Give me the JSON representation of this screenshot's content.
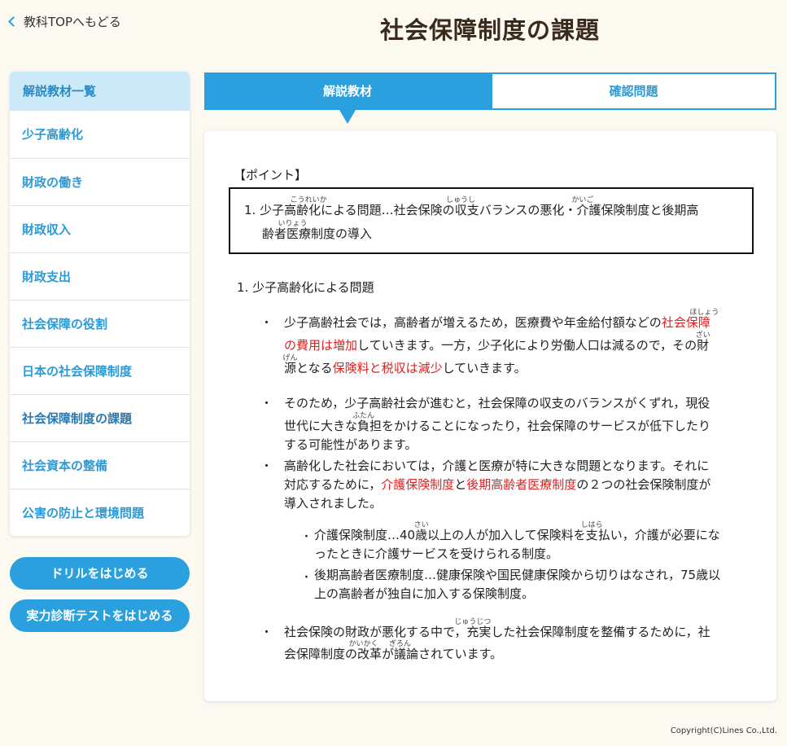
{
  "back_link": "教科TOPへもどる",
  "title": "社会保障制度の課題",
  "sidebar": {
    "header": "解説教材一覧",
    "items": [
      "少子高齢化",
      "財政の働き",
      "財政収入",
      "財政支出",
      "社会保障の役割",
      "日本の社会保障制度",
      "社会保障制度の課題",
      "社会資本の整備",
      "公害の防止と環境問題"
    ],
    "active_index": 6
  },
  "buttons": {
    "drill": "ドリルをはじめる",
    "test": "実力診断テストをはじめる"
  },
  "tabs": {
    "explanation": "解説教材",
    "quiz": "確認問題"
  },
  "content": {
    "point_label": "【ポイント】",
    "point": {
      "line1_a": "1. 少子高",
      "line1_a_ruby_base": "齢化",
      "line1_a_ruby": "こうれいか",
      "line1_b": "による問題…社会保険の",
      "line1_b_ruby_base": "収",
      "line1_b_ruby": "しゅうし",
      "line1_c": "支バランスの悪化・",
      "line1_c_ruby_base": "介",
      "line1_c_ruby": "かいご",
      "line1_d": "護保険制度と後期高",
      "line2_a": "齢者",
      "line2_a_ruby_base": "医",
      "line2_a_ruby": "いりょう",
      "line2_b": "療制度の導入"
    },
    "section1_title": "1. 少子高齢化による問題",
    "b1": {
      "l1_a": "少子高齢社会では，高齢者が増えるため，医療費や年金給付額などの",
      "l1_red": "社会保",
      "l1_ruby_base": "障",
      "l1_ruby": "ほしょう",
      "l2_red": "の費用は増加",
      "l2_a": "していきます。一方，少子化により労働人口は減るので，その",
      "l2_ruby_base": "財",
      "l2_ruby": "ざい",
      "l3_ruby_base": "源",
      "l3_ruby": "げん",
      "l3_a": "となる",
      "l3_red": "保険料と税収は減少",
      "l3_b": "していきます。"
    },
    "b2": {
      "l1": "そのため，少子高齢社会が進むと，社会保障の収支のバランスがくずれ，現役",
      "l2_a": "世代に大きな",
      "l2_ruby_base": "負",
      "l2_ruby": "ふたん",
      "l2_b": "担をかけることになったり，社会保障のサービスが低下したり",
      "l3": "する可能性があります。"
    },
    "b3": {
      "l1": "高齢化した社会においては，介護と医療が特に大きな問題となります。それに",
      "l2_a": "対応するために，",
      "l2_red1": "介護保険制度",
      "l2_b": "と",
      "l2_red2": "後期高齢者医療制度",
      "l2_c": "の２つの社会保険制度が",
      "l3": "導入されました。"
    },
    "sub1": {
      "l1_a": "介護保険制度…40",
      "l1_ruby_base": "歳",
      "l1_ruby": "さい",
      "l1_b": "以上の人が加入して保険料を",
      "l1_ruby2_base": "支",
      "l1_ruby2": "しはら",
      "l1_c": "払い，介護が必要にな",
      "l2": "ったときに介護サービスを受けられる制度。"
    },
    "sub2": {
      "l1": "後期高齢者医療制度…健康保険や国民健康保険から切りはなされ，75歳以",
      "l2": "上の高齢者が独自に加入する保険制度。"
    },
    "b4": {
      "l1_a": "社会保険の財政が悪化する中で，",
      "l1_ruby_base": "充",
      "l1_ruby": "じゅうじつ",
      "l1_b": "実した社会保障制度を整備するために，社",
      "l2_a": "会保障制度の",
      "l2_ruby_base": "改",
      "l2_ruby": "かいかく",
      "l2_b": "革が",
      "l2_ruby2_base": "議",
      "l2_ruby2": "ぎろん",
      "l2_c": "論されています。"
    }
  },
  "copyright": "Copyright(C)Lines Co.,Ltd.",
  "colors": {
    "accent": "#2aa1de",
    "highlight": "#e02020",
    "background": "#fbf9f0"
  }
}
